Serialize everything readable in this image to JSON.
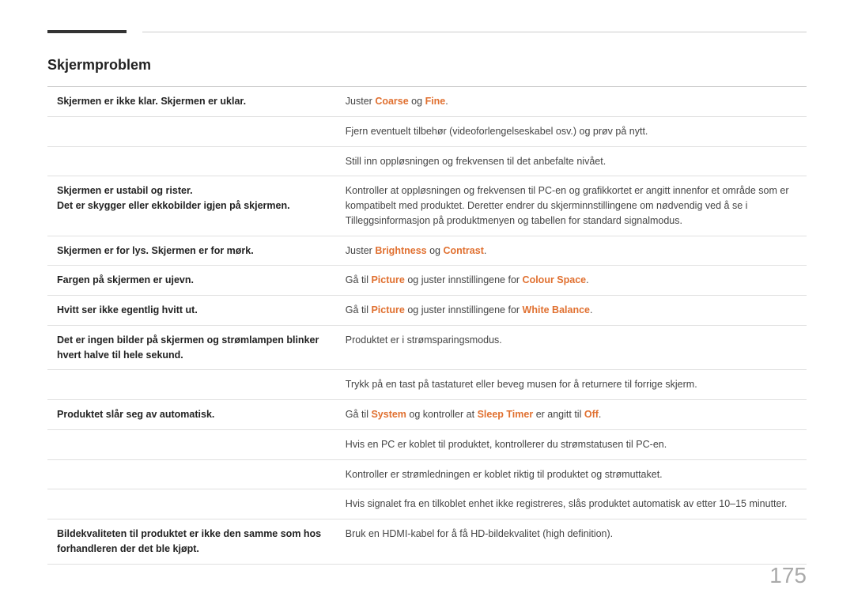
{
  "header": {
    "title": "Skjermproblem"
  },
  "page_number": "175",
  "rows": [
    {
      "id": "row1",
      "left": [
        {
          "text": "Skjermen er ikke klar. Skjermen er uklar.",
          "bold": true
        }
      ],
      "right": [
        {
          "text": "Juster ",
          "bold": false
        },
        {
          "text": "Coarse",
          "bold": true,
          "orange": true
        },
        {
          "text": " og ",
          "bold": false
        },
        {
          "text": "Fine",
          "bold": true,
          "orange": true
        },
        {
          "text": ".",
          "bold": false
        }
      ],
      "rowspan": 3
    },
    {
      "id": "row1b",
      "left_empty": true,
      "right": [
        {
          "text": "Fjern eventuelt tilbehør (videoforlengelseskabel osv.) og prøv på nytt.",
          "bold": false
        }
      ]
    },
    {
      "id": "row1c",
      "left_empty": true,
      "right": [
        {
          "text": "Still inn oppløsningen og frekvensen til det anbefalte nivået.",
          "bold": false
        }
      ]
    },
    {
      "id": "row2",
      "left": [
        {
          "text": "Skjermen er ustabil og rister.",
          "bold": true
        },
        {
          "newline": true
        },
        {
          "text": "Det er skygger eller ekkobilder igjen på skjermen.",
          "bold": true
        }
      ],
      "right": [
        {
          "text": "Kontroller at oppløsningen og frekvensen til PC-en og grafikkortet er angitt innenfor et område som er kompatibelt med produktet. Deretter endrer du skjerminnstillingene om nødvendig ved å se i Tilleggsinformasjon på produktmenyen og tabellen for standard signalmodus.",
          "bold": false
        }
      ]
    },
    {
      "id": "row3",
      "left": [
        {
          "text": "Skjermen er for lys. Skjermen er for mørk.",
          "bold": true
        }
      ],
      "right": [
        {
          "text": "Juster ",
          "bold": false
        },
        {
          "text": "Brightness",
          "bold": true,
          "orange": true
        },
        {
          "text": " og ",
          "bold": false
        },
        {
          "text": "Contrast",
          "bold": true,
          "orange": true
        },
        {
          "text": ".",
          "bold": false
        }
      ]
    },
    {
      "id": "row4",
      "left": [
        {
          "text": "Fargen på skjermen er ujevn.",
          "bold": true
        }
      ],
      "right": [
        {
          "text": "Gå til ",
          "bold": false
        },
        {
          "text": "Picture",
          "bold": true,
          "orange": true
        },
        {
          "text": " og juster innstillingene for ",
          "bold": false
        },
        {
          "text": "Colour Space",
          "bold": true,
          "orange": true
        },
        {
          "text": ".",
          "bold": false
        }
      ]
    },
    {
      "id": "row5",
      "left": [
        {
          "text": "Hvitt ser ikke egentlig hvitt ut.",
          "bold": true
        }
      ],
      "right": [
        {
          "text": "Gå til ",
          "bold": false
        },
        {
          "text": "Picture",
          "bold": true,
          "orange": true
        },
        {
          "text": " og juster innstillingene for ",
          "bold": false
        },
        {
          "text": "White Balance",
          "bold": true,
          "orange": true
        },
        {
          "text": ".",
          "bold": false
        }
      ]
    },
    {
      "id": "row6",
      "left": [
        {
          "text": "Det er ingen bilder på skjermen og strømlampen blinker hvert halve til hele sekund.",
          "bold": true
        }
      ],
      "right": [
        {
          "text": "Produktet er i strømsparingsmodus.",
          "bold": false
        }
      ]
    },
    {
      "id": "row6b",
      "left_empty": true,
      "right": [
        {
          "text": "Trykk på en tast på tastaturet eller beveg musen for å returnere til forrige skjerm.",
          "bold": false
        }
      ]
    },
    {
      "id": "row7",
      "left": [
        {
          "text": "Produktet slår seg av automatisk.",
          "bold": true
        }
      ],
      "right": [
        {
          "text": "Gå til ",
          "bold": false
        },
        {
          "text": "System",
          "bold": true,
          "orange": true
        },
        {
          "text": " og kontroller at ",
          "bold": false
        },
        {
          "text": "Sleep Timer",
          "bold": true,
          "orange": true
        },
        {
          "text": " er angitt til ",
          "bold": false
        },
        {
          "text": "Off",
          "bold": true,
          "orange": true
        },
        {
          "text": ".",
          "bold": false
        }
      ]
    },
    {
      "id": "row7b",
      "left_empty": true,
      "right": [
        {
          "text": "Hvis en PC er koblet til produktet, kontrollerer du strømstatusen til PC-en.",
          "bold": false
        }
      ]
    },
    {
      "id": "row7c",
      "left_empty": true,
      "right": [
        {
          "text": "Kontroller er strømledningen er koblet riktig til produktet og strømuttaket.",
          "bold": false
        }
      ]
    },
    {
      "id": "row7d",
      "left_empty": true,
      "right": [
        {
          "text": "Hvis signalet fra en tilkoblet enhet ikke registreres, slås produktet automatisk av etter 10–15 minutter.",
          "bold": false
        }
      ]
    },
    {
      "id": "row8",
      "left": [
        {
          "text": "Bildekvaliteten til produktet er ikke den samme som hos forhandleren der det ble kjøpt.",
          "bold": true
        }
      ],
      "right": [
        {
          "text": "Bruk en HDMI-kabel for å få HD-bildekvalitet (high definition).",
          "bold": false
        }
      ]
    }
  ]
}
